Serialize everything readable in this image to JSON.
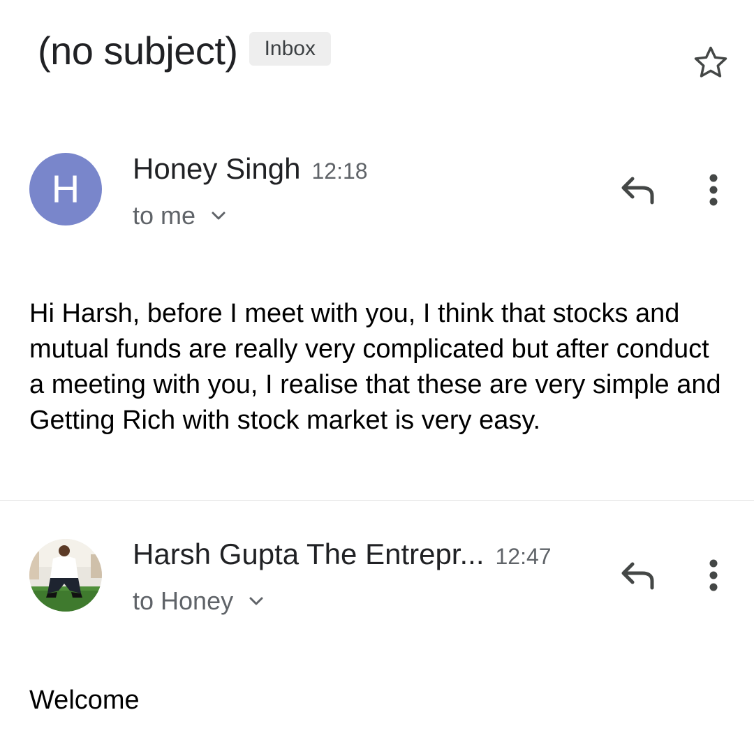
{
  "thread": {
    "subject": "(no subject)",
    "label": "Inbox"
  },
  "messages": [
    {
      "avatar_letter": "H",
      "avatar_color": "#7986cb",
      "sender": "Honey Singh",
      "time": "12:18",
      "recipient": "to me",
      "body": "Hi Harsh, before I meet with you, I think that stocks and mutual funds are really very complicated but after conduct a meeting with you, I realise that these are very simple and Getting Rich with stock market is very easy."
    },
    {
      "avatar_type": "photo",
      "sender": "Harsh Gupta The Entrepr...",
      "time": "12:47",
      "recipient": "to Honey",
      "body": "Welcome"
    }
  ],
  "icons": {
    "star": "star-outline-icon",
    "reply": "reply-icon",
    "more": "more-vert-icon",
    "expand": "chevron-down-icon"
  }
}
